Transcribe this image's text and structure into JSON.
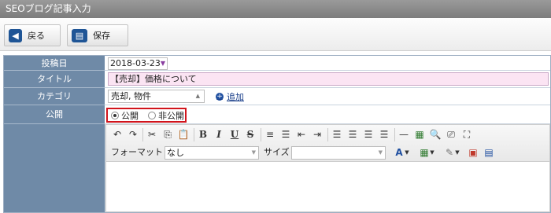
{
  "window": {
    "title": "SEOブログ記事入力"
  },
  "toolbar": {
    "back_label": "戻る",
    "save_label": "保存"
  },
  "form": {
    "date": {
      "label": "投稿日",
      "value": "2018-03-23"
    },
    "title": {
      "label": "タイトル",
      "value": "【売却】価格について"
    },
    "category": {
      "label": "カテゴリ",
      "value": "売却, 物件",
      "add_label": "追加"
    },
    "publish": {
      "label": "公開",
      "options": [
        "公開",
        "非公開"
      ],
      "selected": "公開"
    }
  },
  "editor": {
    "format_label": "フォーマット",
    "format_value": "なし",
    "size_label": "サイズ",
    "size_value": "",
    "bold": "B",
    "italic": "I",
    "underline": "U",
    "strike": "S"
  }
}
